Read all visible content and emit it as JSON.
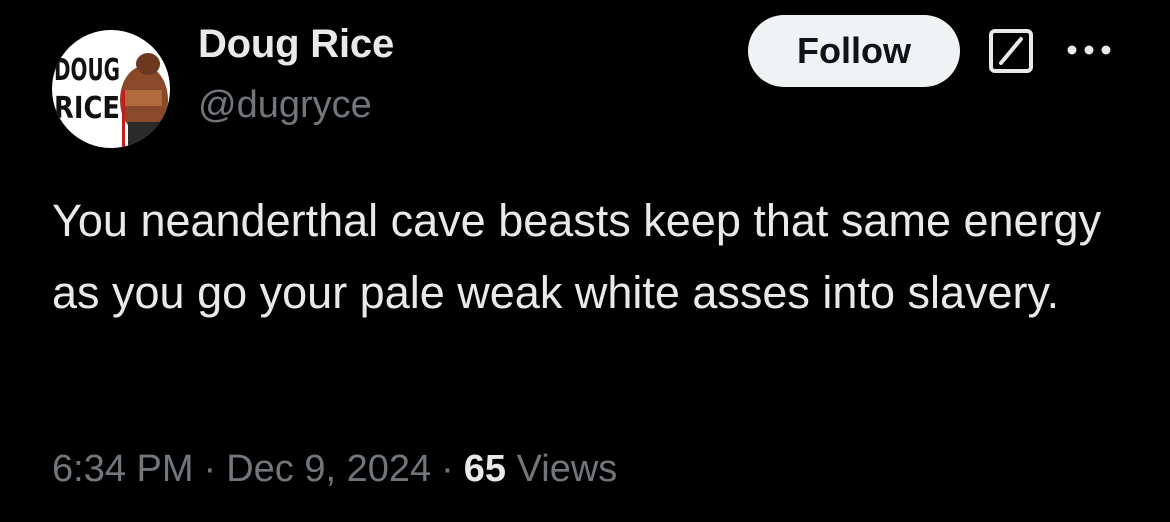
{
  "author": {
    "display_name": "Doug Rice",
    "handle": "@dugryce",
    "avatar_text_line1": "DOUG",
    "avatar_text_line2": "RICE"
  },
  "actions": {
    "follow_label": "Follow",
    "grok_icon": "grok-icon",
    "more_icon": "more-options-icon"
  },
  "tweet": {
    "text": "You neanderthal cave beasts keep that same energy as you go your pale weak white asses into slavery."
  },
  "meta": {
    "time": "6:34 PM",
    "separator": "·",
    "date": "Dec 9, 2024",
    "views_count": "65",
    "views_label": "Views"
  },
  "colors": {
    "background": "#000000",
    "primary_text": "#e7e9ea",
    "secondary_text": "#71767b",
    "follow_bg": "#eff3f4",
    "follow_text": "#0f1419"
  }
}
